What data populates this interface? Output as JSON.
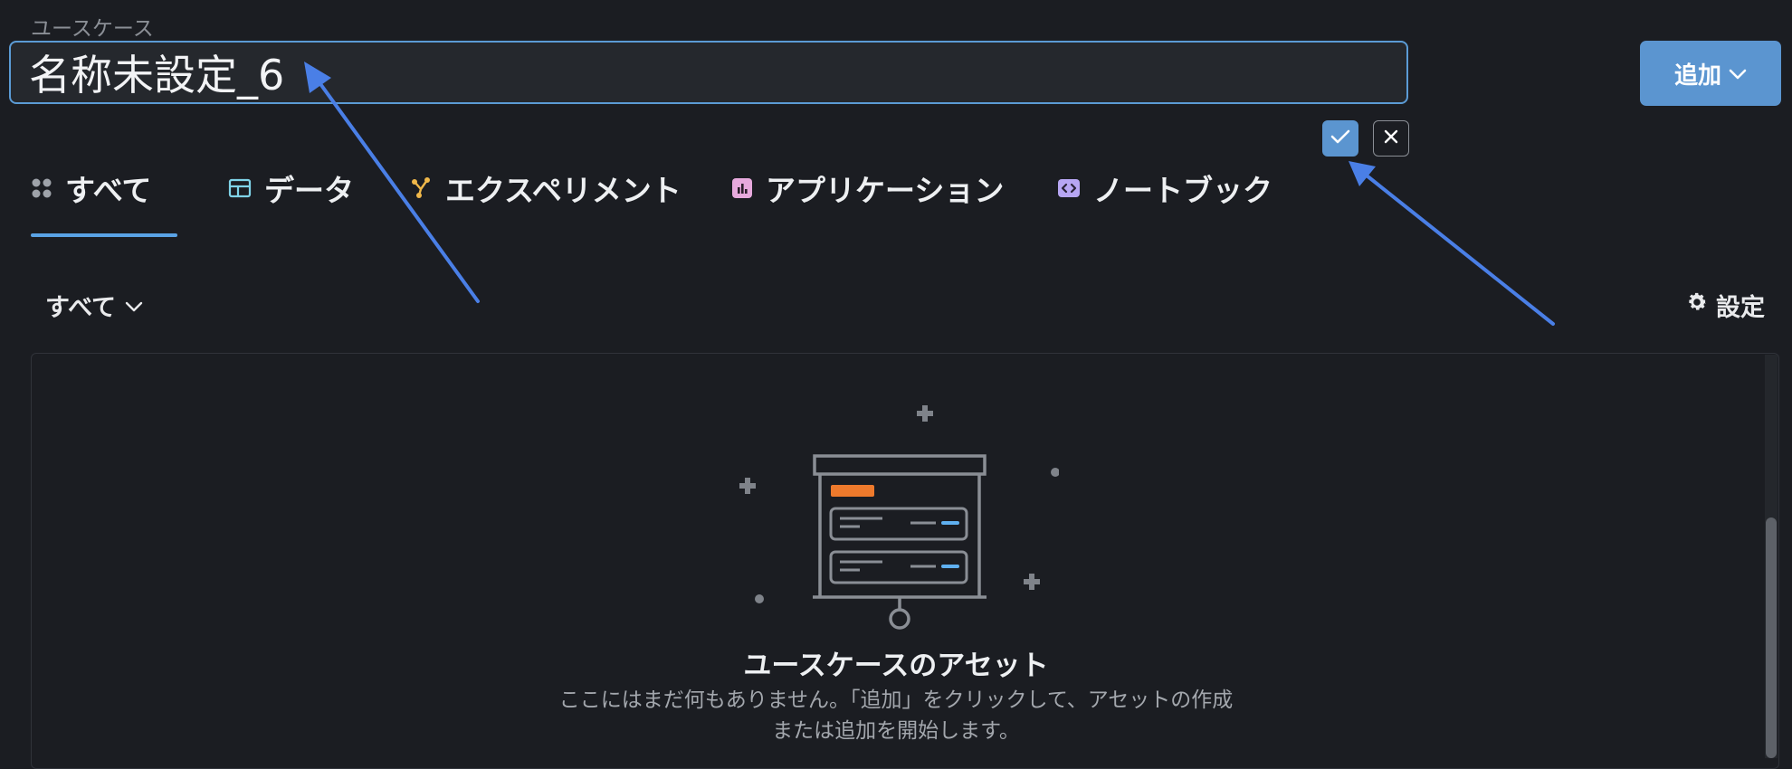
{
  "header": {
    "field_label": "ユースケース",
    "name_value": "名称未設定_6",
    "add_label": "追加"
  },
  "tabs": [
    {
      "label": "すべて",
      "icon": "grid-dots-icon",
      "active": true
    },
    {
      "label": "データ",
      "icon": "table-icon"
    },
    {
      "label": "エクスペリメント",
      "icon": "experiment-icon"
    },
    {
      "label": "アプリケーション",
      "icon": "chart-icon"
    },
    {
      "label": "ノートブック",
      "icon": "code-icon"
    }
  ],
  "filter": {
    "label": "すべて"
  },
  "settings": {
    "label": "設定"
  },
  "empty_state": {
    "title": "ユースケースのアセット",
    "desc_line1": "ここにはまだ何もありません。「追加」をクリックして、アセットの作成",
    "desc_line2": "または追加を開始します。"
  },
  "colors": {
    "background": "#1b1d22",
    "accent": "#5b95d0",
    "tab_underline": "#5aa3e6",
    "annotation_arrow": "#4a7fe6"
  }
}
